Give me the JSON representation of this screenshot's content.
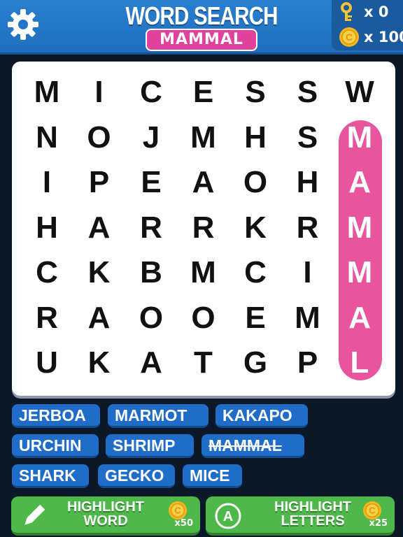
{
  "header": {
    "title": "WORD SEARCH",
    "category": "MAMMAL",
    "keys_count": "x 0",
    "coins_count": "x 100",
    "settings_icon": "gear-icon",
    "key_icon": "key-icon",
    "coin_icon": "coin-icon"
  },
  "grid": {
    "rows": [
      [
        "M",
        "I",
        "C",
        "E",
        "S",
        "S",
        "W"
      ],
      [
        "N",
        "O",
        "J",
        "M",
        "H",
        "S",
        "M"
      ],
      [
        "I",
        "P",
        "E",
        "A",
        "O",
        "H",
        "A"
      ],
      [
        "H",
        "A",
        "R",
        "R",
        "K",
        "R",
        "M"
      ],
      [
        "C",
        "K",
        "B",
        "M",
        "C",
        "I",
        "M"
      ],
      [
        "R",
        "A",
        "O",
        "O",
        "E",
        "M",
        "A"
      ],
      [
        "U",
        "K",
        "A",
        "T",
        "G",
        "P",
        "L"
      ]
    ],
    "found_word": "MAMMAL",
    "highlight_color": "#e8559e"
  },
  "words": [
    {
      "label": "JERBOA",
      "found": false
    },
    {
      "label": "MARMOT",
      "found": false
    },
    {
      "label": "KAKAPO",
      "found": false
    },
    {
      "label": "URCHIN",
      "found": false
    },
    {
      "label": "SHRIMP",
      "found": false
    },
    {
      "label": "MAMMAL",
      "found": true
    },
    {
      "label": "SHARK",
      "found": false
    },
    {
      "label": "GECKO",
      "found": false
    },
    {
      "label": "MICE",
      "found": false
    }
  ],
  "buttons": {
    "highlight_word": {
      "line1": "HIGHLIGHT",
      "line2": "WORD",
      "cost": "x50",
      "icon": "pencil-icon"
    },
    "highlight_letters": {
      "line1": "HIGHLIGHT",
      "line2": "LETTERS",
      "cost": "x25",
      "icon": "letter-a-icon"
    }
  },
  "colors": {
    "header_blue": "#2a7fd0",
    "category_pink": "#e1409c",
    "chip_blue": "#1f6cc9",
    "button_green": "#4fb84a",
    "background": "#0b1828"
  }
}
